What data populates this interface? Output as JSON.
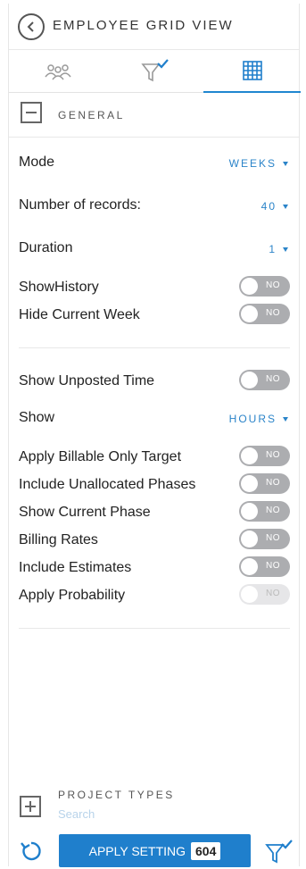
{
  "header": {
    "title": "EMPLOYEE GRID VIEW"
  },
  "tabs": [
    {
      "icon": "people-icon"
    },
    {
      "icon": "filter-check-icon"
    },
    {
      "icon": "grid-icon",
      "active": true
    }
  ],
  "general": {
    "label": "GENERAL",
    "mode": {
      "label": "Mode",
      "value": "WEEKS"
    },
    "records": {
      "label": "Number of records:",
      "value": "40"
    },
    "duration": {
      "label": "Duration",
      "value": "1"
    },
    "show_history": {
      "label": "ShowHistory",
      "toggle": "NO"
    },
    "hide_current_week": {
      "label": "Hide Current Week",
      "toggle": "NO"
    },
    "show_unposted_time": {
      "label": "Show Unposted Time",
      "toggle": "NO"
    },
    "show": {
      "label": "Show",
      "value": "HOURS"
    },
    "apply_billable_only_target": {
      "label": "Apply Billable Only Target",
      "toggle": "NO"
    },
    "include_unallocated_phases": {
      "label": "Include Unallocated Phases",
      "toggle": "NO"
    },
    "show_current_phase": {
      "label": "Show Current Phase",
      "toggle": "NO"
    },
    "billing_rates": {
      "label": "Billing Rates",
      "toggle": "NO"
    },
    "include_estimates": {
      "label": "Include Estimates",
      "toggle": "NO"
    },
    "apply_probability": {
      "label": "Apply Probability",
      "toggle": "NO"
    }
  },
  "project_types": {
    "label": "PROJECT TYPES",
    "search_placeholder": "Search"
  },
  "footer": {
    "apply_label": "APPLY SETTING",
    "apply_count": "604"
  },
  "colors": {
    "accent": "#1f7fcc",
    "toggle_off": "#acadb0"
  }
}
